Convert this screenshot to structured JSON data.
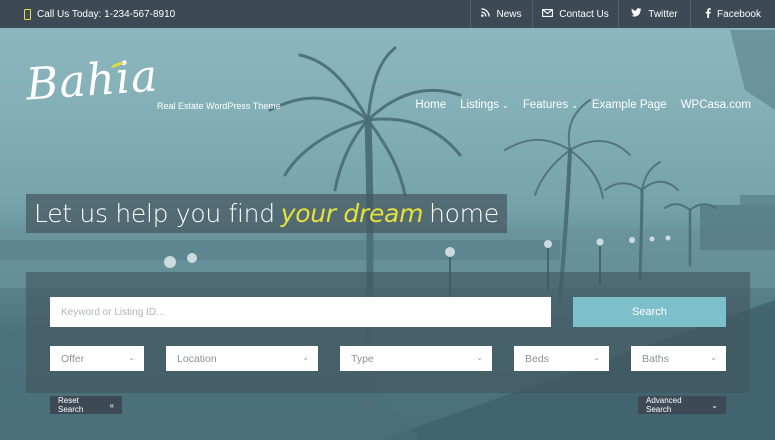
{
  "topbar": {
    "call": "Call Us Today: 1-234-567-8910",
    "links": [
      {
        "label": "News",
        "icon": "rss-icon"
      },
      {
        "label": "Contact Us",
        "icon": "envelope-icon"
      },
      {
        "label": "Twitter",
        "icon": "twitter-icon"
      },
      {
        "label": "Facebook",
        "icon": "facebook-icon"
      }
    ]
  },
  "header": {
    "logo": "Bahia",
    "tagline": "Real Estate WordPress Theme",
    "nav": [
      {
        "label": "Home",
        "dropdown": false
      },
      {
        "label": "Listings",
        "dropdown": true
      },
      {
        "label": "Features",
        "dropdown": true
      },
      {
        "label": "Example Page",
        "dropdown": false
      },
      {
        "label": "WPCasa.com",
        "dropdown": false
      }
    ]
  },
  "hero": {
    "headline_pre": "Let us help you find",
    "headline_highlight": "your dream",
    "headline_post": "home"
  },
  "search": {
    "keyword_placeholder": "Keyword or Listing ID...",
    "search_label": "Search",
    "filters": {
      "offer": "Offer",
      "location": "Location",
      "type": "Type",
      "beds": "Beds",
      "baths": "Baths"
    },
    "reset_label": "Reset Search",
    "advanced_label": "Advanced Search"
  },
  "colors": {
    "accent": "#e6e03a",
    "topbar": "#3d4a55",
    "search_button": "#7dbfcb"
  }
}
